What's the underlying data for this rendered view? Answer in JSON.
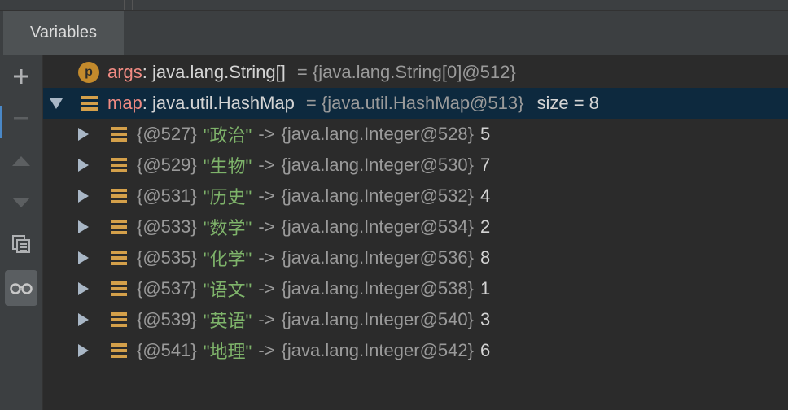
{
  "panel": {
    "tab_label": "Variables"
  },
  "toolbar": {
    "buttons": [
      {
        "icon": "plus-icon",
        "symbol": "+"
      },
      {
        "icon": "minus-icon",
        "symbol": "—"
      },
      {
        "icon": "arrow-up-icon",
        "symbol": "▲"
      },
      {
        "icon": "arrow-down-icon",
        "symbol": "▼"
      },
      {
        "icon": "copy-icon",
        "symbol": ""
      },
      {
        "icon": "glasses-icon",
        "symbol": ""
      }
    ]
  },
  "variables": {
    "args": {
      "badge": "p",
      "name": "args",
      "type": ": java.lang.String[]",
      "value": "= {java.lang.String[0]@512}"
    },
    "map": {
      "name": "map",
      "type": ": java.util.HashMap",
      "value": "= {java.util.HashMap@513}",
      "size": "size = 8",
      "entries": [
        {
          "ref": "{@527}",
          "key": "\"政治\"",
          "arrow": "->",
          "target": "{java.lang.Integer@528}",
          "value": "5"
        },
        {
          "ref": "{@529}",
          "key": "\"生物\"",
          "arrow": "->",
          "target": "{java.lang.Integer@530}",
          "value": "7"
        },
        {
          "ref": "{@531}",
          "key": "\"历史\"",
          "arrow": "->",
          "target": "{java.lang.Integer@532}",
          "value": "4"
        },
        {
          "ref": "{@533}",
          "key": "\"数学\"",
          "arrow": "->",
          "target": "{java.lang.Integer@534}",
          "value": "2"
        },
        {
          "ref": "{@535}",
          "key": "\"化学\"",
          "arrow": "->",
          "target": "{java.lang.Integer@536}",
          "value": "8"
        },
        {
          "ref": "{@537}",
          "key": "\"语文\"",
          "arrow": "->",
          "target": "{java.lang.Integer@538}",
          "value": "1"
        },
        {
          "ref": "{@539}",
          "key": "\"英语\"",
          "arrow": "->",
          "target": "{java.lang.Integer@540}",
          "value": "3"
        },
        {
          "ref": "{@541}",
          "key": "\"地理\"",
          "arrow": "->",
          "target": "{java.lang.Integer@542}",
          "value": "6"
        }
      ]
    }
  },
  "colors": {
    "background": "#2b2b2b",
    "selected_row": "#0d293e",
    "variable_name": "#f28b83",
    "string_key": "#7eb36a",
    "field_icon": "#d4a04a"
  }
}
